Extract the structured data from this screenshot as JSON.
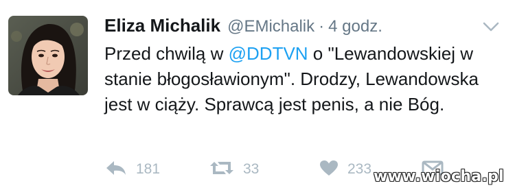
{
  "tweet": {
    "author_name": "Eliza Michalik",
    "author_handle": "@EMichalik",
    "separator": "·",
    "timestamp": "4 godz.",
    "text_parts": {
      "before_mention": "Przed chwilą w ",
      "mention": "@DDTVN",
      "after_mention": " o \"Lewandowskiej w stanie błogosławionym\". Drodzy, Lewandowska jest w ciąży. Sprawcą jest penis, a nie Bóg."
    },
    "actions": {
      "reply_count": "181",
      "retweet_count": "33",
      "like_count": "233"
    }
  },
  "icons": {
    "caret": "chevron-down-icon",
    "reply": "reply-icon",
    "retweet": "retweet-icon",
    "like": "heart-icon",
    "dm": "envelope-icon"
  },
  "colors": {
    "text": "#14171a",
    "secondary": "#657786",
    "mention": "#1da1f2",
    "action_icon": "#aab8c2"
  },
  "watermark": "www.wiocha.pl"
}
